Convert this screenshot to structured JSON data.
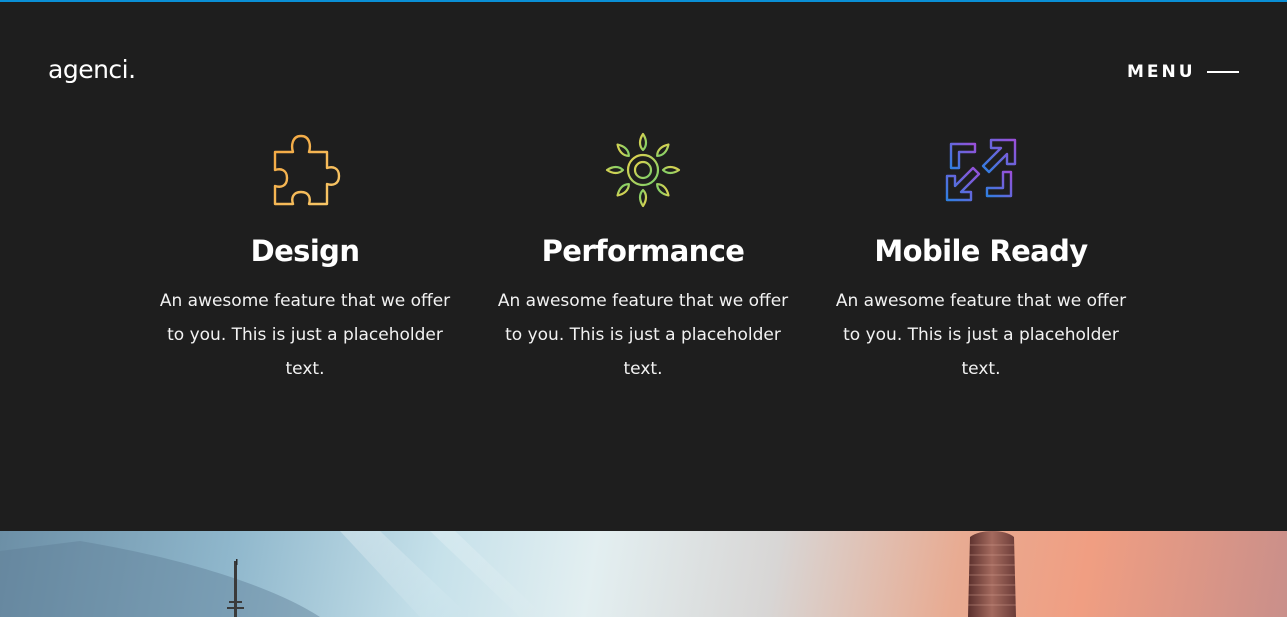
{
  "header": {
    "logo_text": "agenci.",
    "menu_label": "MENU"
  },
  "features": [
    {
      "title": "Design",
      "text": "An awesome feature that we offer to you. This is just a placeholder text.",
      "icon": "puzzle-icon",
      "icon_color": "#f0a24a"
    },
    {
      "title": "Performance",
      "text": "An awesome feature that we offer to you. This is just a placeholder text.",
      "icon": "sun-gear-icon",
      "icon_color": "#9bd35a"
    },
    {
      "title": "Mobile Ready",
      "text": "An awesome feature that we offer to you. This is just a placeholder text.",
      "icon": "expand-arrows-icon",
      "icon_color": "#5a6fe0"
    }
  ],
  "colors": {
    "background": "#1e1e1e",
    "accent_bar": "#0a8fd6",
    "text": "#ffffff"
  }
}
